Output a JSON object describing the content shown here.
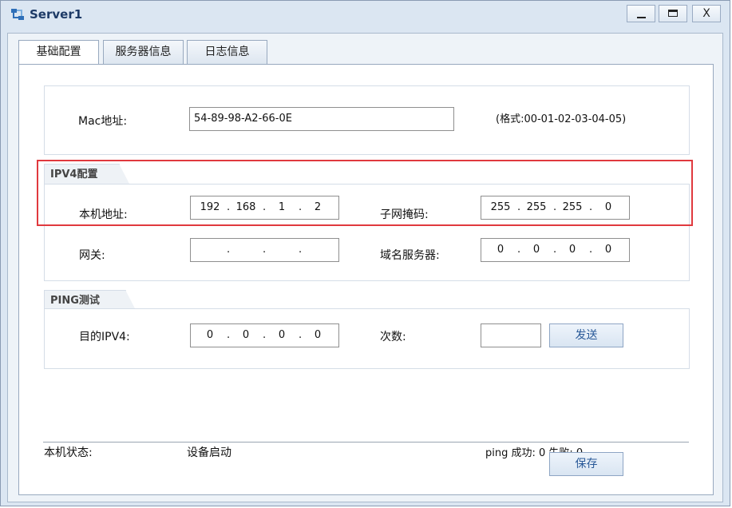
{
  "window": {
    "title": "Server1",
    "close_glyph": "X"
  },
  "tabs": [
    {
      "label": "基础配置"
    },
    {
      "label": "服务器信息"
    },
    {
      "label": "日志信息"
    }
  ],
  "mac": {
    "label": "Mac地址:",
    "value": "54-89-98-A2-66-0E",
    "format_hint": "(格式:00-01-02-03-04-05)"
  },
  "ipv4": {
    "group_title": "IPV4配置",
    "local_ip_label": "本机地址:",
    "local_ip": [
      "192",
      "168",
      "1",
      "2"
    ],
    "mask_label": "子网掩码:",
    "mask": [
      "255",
      "255",
      "255",
      "0"
    ],
    "gateway_label": "网关:",
    "gateway": [
      "",
      "",
      "",
      ""
    ],
    "dns_label": "域名服务器:",
    "dns": [
      "0",
      "0",
      "0",
      "0"
    ]
  },
  "ping": {
    "group_title": "PING测试",
    "dest_label": "目的IPV4:",
    "dest": [
      "0",
      "0",
      "0",
      "0"
    ],
    "count_label": "次数:",
    "count_value": "",
    "send_button": "发送"
  },
  "status": {
    "label": "本机状态:",
    "value": "设备启动",
    "ping_result": "ping 成功: 0 失败: 0"
  },
  "save_button": "保存",
  "colors": {
    "highlight": "#e0393e",
    "accent": "#2a5a99"
  },
  "icons": {
    "app": "server-network-icon"
  }
}
